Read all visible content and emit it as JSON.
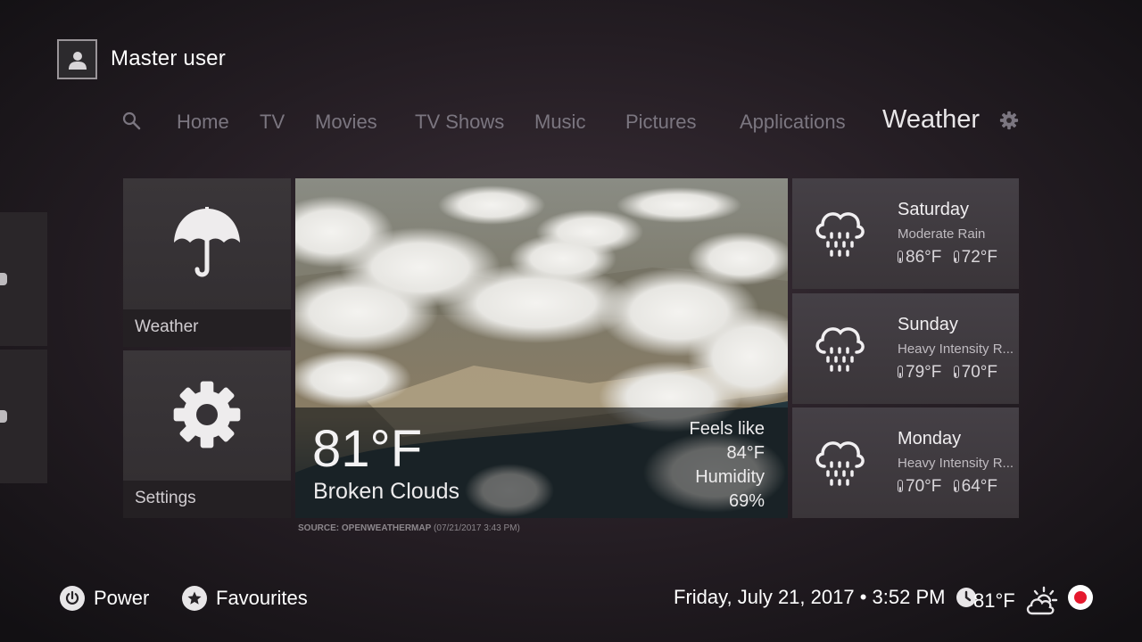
{
  "user": {
    "name": "Master user",
    "avatar_icon": "user-silhouette-icon"
  },
  "nav": {
    "search_icon": "search-icon",
    "items": [
      "Home",
      "TV",
      "Movies",
      "TV Shows",
      "Music",
      "Pictures",
      "Applications",
      "Weather"
    ],
    "active": "Weather",
    "settings_icon": "gear-icon"
  },
  "tiles": {
    "weather": {
      "label": "Weather",
      "icon": "umbrella-icon"
    },
    "settings": {
      "label": "Settings",
      "icon": "gear-icon"
    }
  },
  "current": {
    "temp": "81°F",
    "condition": "Broken Clouds",
    "feels_label": "Feels like",
    "feels_value": "84°F",
    "humidity_label": "Humidity",
    "humidity_value": "69%"
  },
  "source": {
    "label": "SOURCE: OPENWEATHERMAP",
    "stamp": "(07/21/2017 3:43 PM)"
  },
  "forecast": [
    {
      "day": "Saturday",
      "desc": "Moderate Rain",
      "high": "86°F",
      "low": "72°F",
      "icon": "rain-cloud-icon"
    },
    {
      "day": "Sunday",
      "desc": "Heavy Intensity R...",
      "high": "79°F",
      "low": "70°F",
      "icon": "rain-cloud-icon"
    },
    {
      "day": "Monday",
      "desc": "Heavy Intensity R...",
      "high": "70°F",
      "low": "64°F",
      "icon": "rain-cloud-icon"
    }
  ],
  "footer": {
    "power": "Power",
    "favourites": "Favourites",
    "datetime": "Friday, July 21, 2017 • 3:52 PM",
    "temp": "81°F",
    "weather_icon": "partly-cloudy-icon",
    "clock_icon": "clock-icon",
    "record_icon": "record-icon"
  },
  "colors": {
    "accent_record": "#e5182d",
    "nav_inactive": "#7b7680",
    "nav_active": "#e8e6e8"
  }
}
